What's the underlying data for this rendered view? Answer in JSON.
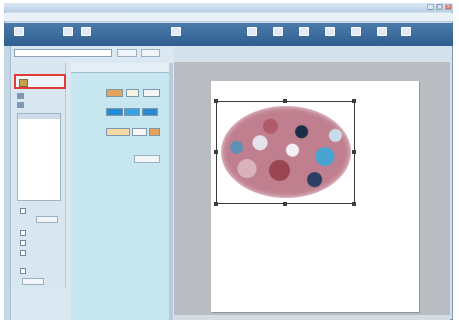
{
  "window": {
    "title": "",
    "controls": [
      "_",
      "□",
      "×"
    ]
  },
  "menu": [
    "",
    "",
    "",
    "",
    ""
  ],
  "ribbon": {
    "buttons": [
      {
        "label": "",
        "icon": "new-icon"
      },
      {
        "label": "",
        "icon": "open-icon"
      },
      {
        "label": "",
        "icon": "tool-icon"
      },
      {
        "label": "",
        "icon": "tool-icon"
      },
      {
        "label": "",
        "icon": "tool-icon"
      },
      {
        "label": "",
        "icon": "tool-icon"
      },
      {
        "label": "",
        "icon": "tool-icon"
      },
      {
        "label": "",
        "icon": "tool-icon"
      },
      {
        "label": "",
        "icon": "tool-icon"
      },
      {
        "label": "",
        "icon": "tool-icon"
      },
      {
        "label": "",
        "icon": "tool-icon"
      }
    ]
  },
  "toolbar_row": {
    "combo_value": "",
    "button1": "",
    "button2": ""
  },
  "tools": {
    "heading": "",
    "selected_label": "",
    "items": [
      {
        "label": ""
      },
      {
        "label": ""
      }
    ],
    "layer_item": "",
    "options": [
      {
        "label": ""
      },
      {
        "label": ""
      },
      {
        "label": ""
      },
      {
        "label": ""
      },
      {
        "label": ""
      }
    ],
    "buttons": [
      "",
      ""
    ],
    "side_label": ""
  },
  "properties": {
    "tabs": [
      "",
      "",
      ""
    ],
    "rows": [
      {
        "label": ""
      },
      {
        "label": ""
      },
      {
        "label": ""
      }
    ],
    "apply_label": ""
  },
  "colors": {
    "ribbon": "#2f5e8f",
    "properties_bg": "#c6e7ef",
    "highlight": "#e03a3a",
    "fill_blue": "#1f8fd6",
    "fill_orange": "#e2a45a"
  }
}
